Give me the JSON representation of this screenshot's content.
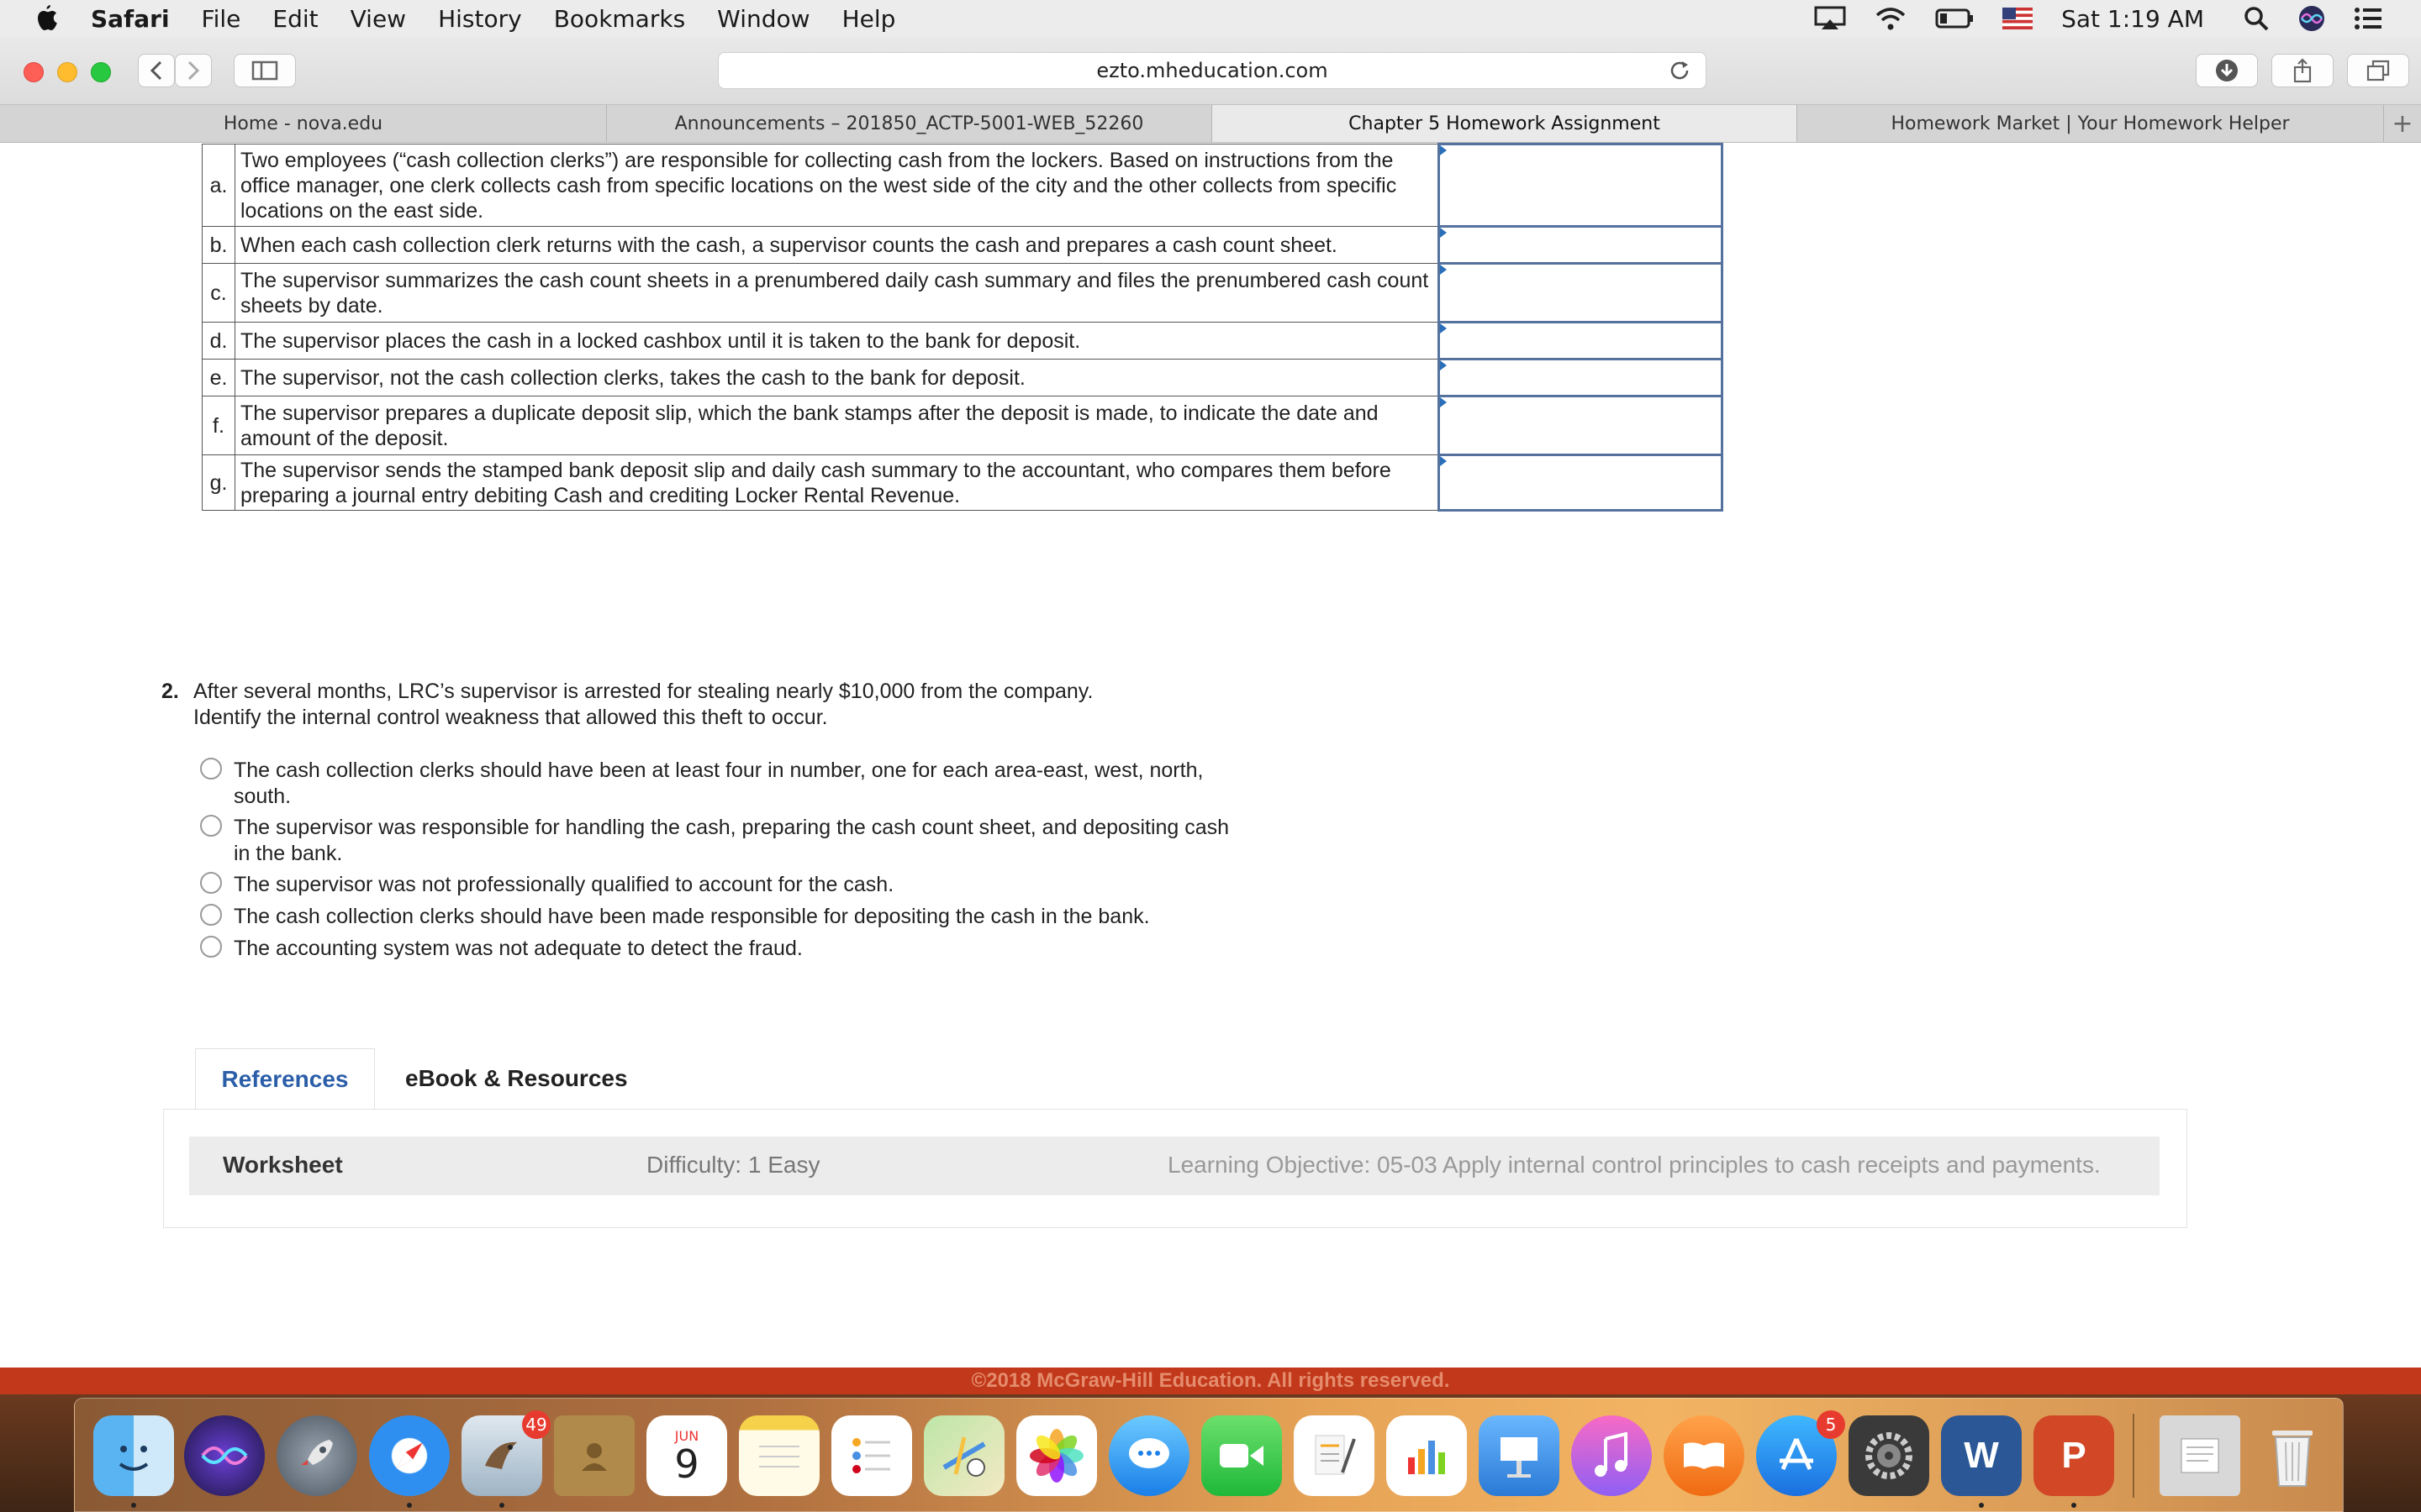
{
  "menubar": {
    "app_name": "Safari",
    "items": [
      "File",
      "Edit",
      "View",
      "History",
      "Bookmarks",
      "Window",
      "Help"
    ],
    "clock": "Sat 1:19 AM"
  },
  "browser": {
    "url": "ezto.mheducation.com",
    "tabs": [
      {
        "label": "Home - nova.edu"
      },
      {
        "label": "Announcements – 201850_ACTP-5001-WEB_52260"
      },
      {
        "label": "Chapter 5 Homework Assignment"
      },
      {
        "label": "Homework Market | Your Homework Helper"
      }
    ],
    "new_tab": "+"
  },
  "question1": {
    "rows": [
      {
        "letter": "a.",
        "text": "Two employees (“cash collection clerks”) are responsible for collecting cash from the lockers. Based on instructions from the office manager, one clerk collects cash from specific locations on the west side of the city and the other collects from specific locations on the east side."
      },
      {
        "letter": "b.",
        "text": "When each cash collection clerk returns with the cash, a supervisor counts the cash and prepares a cash count sheet."
      },
      {
        "letter": "c.",
        "text": "The supervisor summarizes the cash count sheets in a prenumbered daily cash summary and files the prenumbered cash count sheets by date."
      },
      {
        "letter": "d.",
        "text": "The supervisor places the cash in a locked cashbox until it is taken to the bank for deposit."
      },
      {
        "letter": "e.",
        "text": "The supervisor, not the cash collection clerks, takes the cash to the bank for deposit."
      },
      {
        "letter": "f.",
        "text": "The supervisor prepares a duplicate deposit slip, which the bank stamps after the deposit is made, to indicate the date and amount of the deposit."
      },
      {
        "letter": "g.",
        "text": "The supervisor sends the stamped bank deposit slip and daily cash summary to the accountant, who compares them before preparing a journal entry debiting Cash and crediting Locker Rental Revenue."
      }
    ]
  },
  "question2": {
    "number": "2.",
    "prompt_line1": "After several months, LRC’s supervisor is arrested for stealing nearly $10,000 from the company.",
    "prompt_line2": "Identify the internal control weakness that allowed this theft to occur.",
    "options": [
      "The cash collection clerks should have been at least four in number, one for each area-east, west, north, south.",
      "The supervisor was responsible for handling the cash, preparing the cash count sheet, and depositing cash in the bank.",
      "The supervisor was not professionally qualified to account for the cash.",
      "The cash collection clerks should have been made responsible for depositing the cash in the bank.",
      "The accounting system was not adequate to detect the fraud."
    ]
  },
  "references": {
    "tab_references": "References",
    "tab_ebook": "eBook & Resources",
    "worksheet": "Worksheet",
    "difficulty": "Difficulty: 1 Easy",
    "learning_objective": "Learning Objective: 05-03 Apply internal control principles to cash receipts and payments."
  },
  "footer": {
    "copyright": "©2018 McGraw-Hill Education. All rights reserved."
  },
  "dock": {
    "badges": {
      "mail": "49",
      "appstore": "5"
    },
    "calendar": {
      "month": "JUN",
      "day": "9"
    },
    "word_letter": "W",
    "powerpoint_letter": "P"
  }
}
